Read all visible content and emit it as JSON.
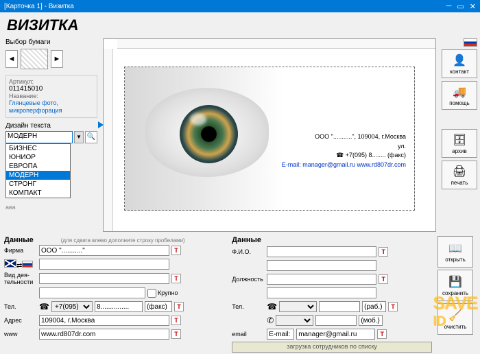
{
  "titlebar": {
    "text": "[Карточка 1] - Визитка"
  },
  "main_title": "ВИЗИТКА",
  "left": {
    "paper_label": "Выбор бумаги",
    "article_lbl": "Артикул:",
    "article_val": "011415010",
    "name_lbl": "Название:",
    "name_val": "Глянцевые фото, микроперфорация",
    "design_lbl": "Дизайн текста",
    "design_selected": "МОДЕРН",
    "options": [
      "БИЗНЕС",
      "ЮНИОР",
      "ЕВРОПА",
      "МОДЕРН",
      "СТРОНГ",
      "КОМПАКТ"
    ],
    "hidden1": "ва",
    "hidden2": "ава"
  },
  "card": {
    "line1": "ООО \"...........\", 109004, г.Москва",
    "line2": "ул.",
    "line3_pre": "☎  +7(095) 8........ (факс)",
    "line4": "E-mail: manager@gmail.ru www.rd807dr.com"
  },
  "tools": {
    "contact": "контакт",
    "help": "помощь",
    "archive": "архив",
    "print": "печать",
    "open": "открыть",
    "save": "сохранить",
    "clear": "очистить"
  },
  "data": {
    "header": "Данные",
    "hint": "(для сдвига влево дополните строку пробелами)",
    "firma_lbl": "Фирма",
    "firma_val": "ООО \"...........\"",
    "vid_lbl": "Вид дея-тельности",
    "krupno": "Крупно",
    "tel_lbl": "Тел.",
    "tel_code": "+7(095)",
    "tel_num": "8...............",
    "tel_suf": "(факс)",
    "addr_lbl": "Адрес",
    "addr_val": "109004, г.Москва",
    "www_lbl": "www",
    "www_val": "www.rd807dr.com",
    "fio_lbl": "Ф.И.О.",
    "pos_lbl": "Должность",
    "rab": "(раб.)",
    "mob": "(моб.)",
    "email_lbl": "email",
    "email_pre": "E-mail:",
    "email_val": "manager@gmail.ru",
    "load_btn": "загрузка сотрудников по списку"
  },
  "watermark": {
    "l1": "SAVE",
    "l2": "ID"
  }
}
